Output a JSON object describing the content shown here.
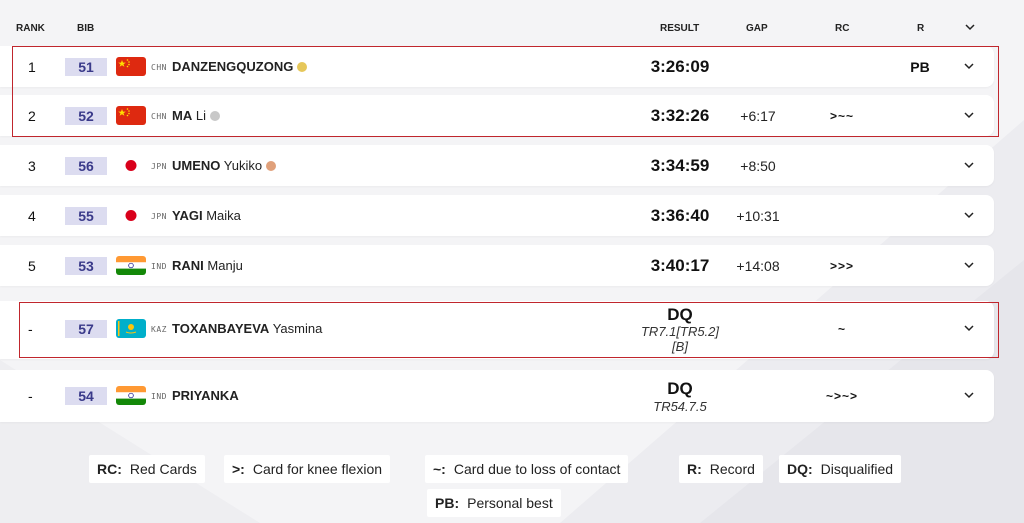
{
  "header": {
    "rank": "RANK",
    "bib": "BIB",
    "result": "RESULT",
    "gap": "GAP",
    "rc": "RC",
    "r": "R",
    "expand_icon": "chevron-down-icon"
  },
  "colors": {
    "bib_bg": "#dcdcf0",
    "bib_text": "#3a3a8a",
    "highlight": "#c0262d",
    "gold": "#e6c75a",
    "silver": "#c8c8c8",
    "bronze": "#e0a07a"
  },
  "rows": [
    {
      "rank": "1",
      "bib": "51",
      "flag": "chn-flag",
      "noc": "CHN",
      "surname": "DANZENGQUZONG",
      "given": "",
      "medal": "gold",
      "result": "3:26:09",
      "gap": "",
      "rc": "",
      "record": "PB"
    },
    {
      "rank": "2",
      "bib": "52",
      "flag": "chn-flag",
      "noc": "CHN",
      "surname": "MA",
      "given": "Li",
      "medal": "silver",
      "result": "3:32:26",
      "gap": "+6:17",
      "rc": ">~~",
      "record": ""
    },
    {
      "rank": "3",
      "bib": "56",
      "flag": "jpn-flag",
      "noc": "JPN",
      "surname": "UMENO",
      "given": "Yukiko",
      "medal": "bronze",
      "result": "3:34:59",
      "gap": "+8:50",
      "rc": "",
      "record": ""
    },
    {
      "rank": "4",
      "bib": "55",
      "flag": "jpn-flag",
      "noc": "JPN",
      "surname": "YAGI",
      "given": "Maika",
      "medal": "",
      "result": "3:36:40",
      "gap": "+10:31",
      "rc": "",
      "record": ""
    },
    {
      "rank": "5",
      "bib": "53",
      "flag": "ind-flag",
      "noc": "IND",
      "surname": "RANI",
      "given": "Manju",
      "medal": "",
      "result": "3:40:17",
      "gap": "+14:08",
      "rc": ">>>",
      "record": ""
    },
    {
      "rank": "-",
      "bib": "57",
      "flag": "kaz-flag",
      "noc": "KAZ",
      "surname": "TOXANBAYEVA",
      "given": "Yasmina",
      "medal": "",
      "result": "DQ",
      "result_note_1": "TR7.1[TR5.2]",
      "result_note_2": "[B]",
      "gap": "",
      "rc": "~",
      "record": ""
    },
    {
      "rank": "-",
      "bib": "54",
      "flag": "ind-flag",
      "noc": "IND",
      "surname": "PRIYANKA",
      "given": "",
      "medal": "",
      "result": "DQ",
      "result_note_1": "TR54.7.5",
      "gap": "",
      "rc": "~>~>",
      "record": ""
    }
  ],
  "legend": [
    {
      "key": "RC:",
      "text": "Red Cards"
    },
    {
      "key": ">:",
      "text": "Card for knee flexion"
    },
    {
      "key": "~:",
      "text": "Card due to loss of contact"
    },
    {
      "key": "R:",
      "text": "Record"
    },
    {
      "key": "DQ:",
      "text": "Disqualified"
    },
    {
      "key": "PB:",
      "text": "Personal best"
    }
  ]
}
